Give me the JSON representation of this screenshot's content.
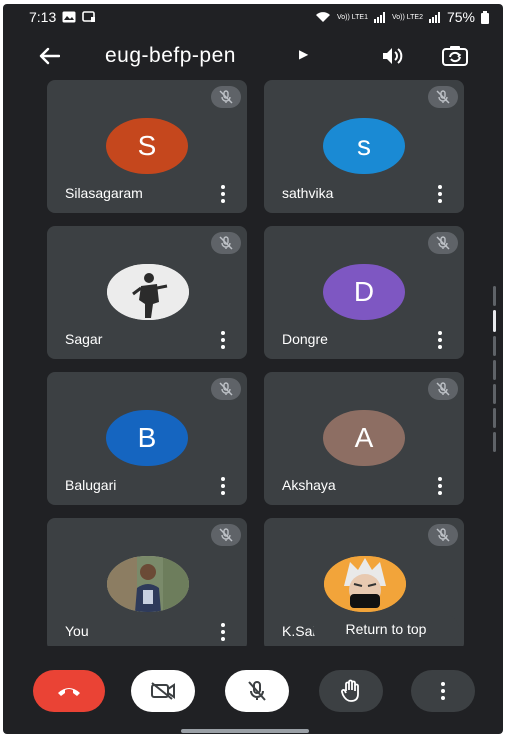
{
  "status_bar": {
    "time": "7:13",
    "network_left": "Vo)) LTE1",
    "network_right": "Vo)) LTE2",
    "battery": "75%"
  },
  "header": {
    "meeting_code": "eug-befp-pen",
    "back_icon": "arrow-left-icon",
    "speaker_icon": "speaker-icon",
    "switch_camera_icon": "switch-camera-icon"
  },
  "participants": [
    {
      "name": "Silasagaram",
      "initial": "S",
      "avatar_color": "#c5471d",
      "photo": false,
      "muted": true
    },
    {
      "name": "sathvika",
      "initial": "s",
      "avatar_color": "#1a8ad4",
      "photo": false,
      "muted": true
    },
    {
      "name": "Sagar",
      "initial": "",
      "avatar_color": "#e9e9e9",
      "photo": true,
      "muted": true
    },
    {
      "name": "Dongre",
      "initial": "D",
      "avatar_color": "#7e57c2",
      "photo": false,
      "muted": true
    },
    {
      "name": "Balugari",
      "initial": "B",
      "avatar_color": "#1565c0",
      "photo": false,
      "muted": true
    },
    {
      "name": "Akshaya",
      "initial": "A",
      "avatar_color": "#8d6e63",
      "photo": false,
      "muted": true
    },
    {
      "name": "You",
      "initial": "",
      "avatar_color": "#c9bfa8",
      "photo": true,
      "muted": true
    },
    {
      "name": "K.Sai",
      "initial": "",
      "avatar_color": "#f2a43a",
      "photo": true,
      "muted": true
    }
  ],
  "return_to_top": "Return to top",
  "controls": {
    "end_call_icon": "end-call-icon",
    "camera_icon": "camera-off-icon",
    "mic_icon": "mic-off-icon",
    "hand_icon": "raise-hand-icon",
    "more_icon": "more-vertical-icon"
  },
  "colors": {
    "background": "#202124",
    "tile": "#3c4043",
    "end_call": "#ea4335"
  }
}
